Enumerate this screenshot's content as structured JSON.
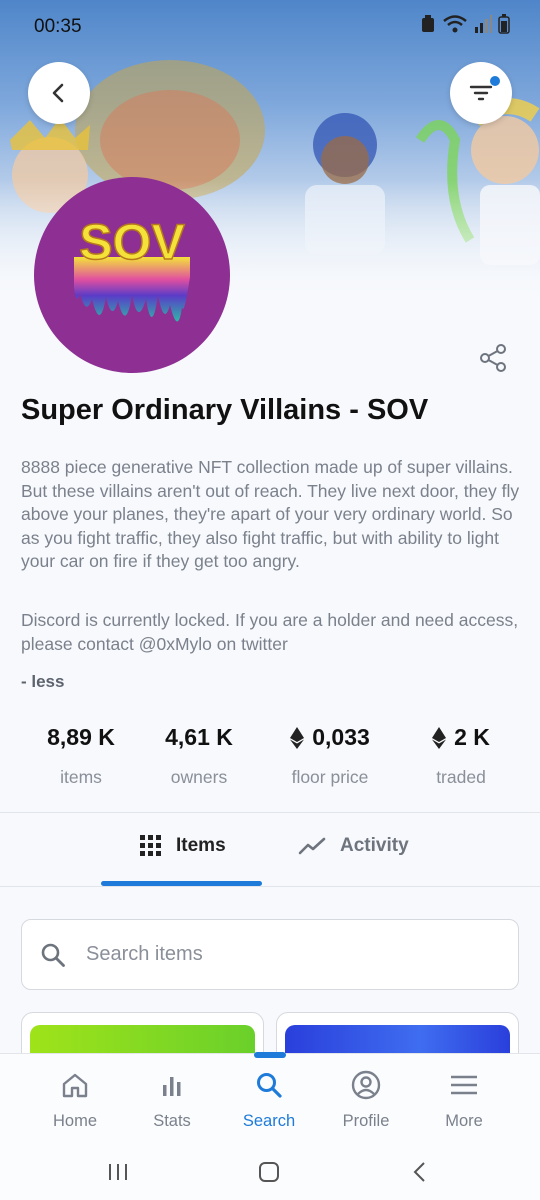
{
  "status": {
    "time": "00:35"
  },
  "collection": {
    "title": "Super Ordinary Villains - SOV",
    "avatar_text": "SOV",
    "description": "8888 piece generative NFT collection made up of super villains. But these villains aren't out of reach. They live next door, they fly above your planes, they're apart of your very ordinary world. So as you fight traffic, they also fight traffic, but with ability to light your car on fire if they get too angry.",
    "description_extra": "Discord is currently locked. If you are a holder and need access, please contact @0xMylo on twitter",
    "toggle_label": "- less"
  },
  "stats": [
    {
      "value": "8,89 K",
      "label": "items",
      "eth": false
    },
    {
      "value": "4,61 K",
      "label": "owners",
      "eth": false
    },
    {
      "value": "0,033",
      "label": "floor price",
      "eth": true
    },
    {
      "value": "2 K",
      "label": "traded",
      "eth": true
    }
  ],
  "tabs": {
    "items": "Items",
    "activity": "Activity"
  },
  "search": {
    "placeholder": "Search items"
  },
  "nav": {
    "home": "Home",
    "stats": "Stats",
    "search": "Search",
    "profile": "Profile",
    "more": "More"
  },
  "colors": {
    "accent": "#1e7bd9",
    "avatar_bg": "#8d2f93"
  }
}
